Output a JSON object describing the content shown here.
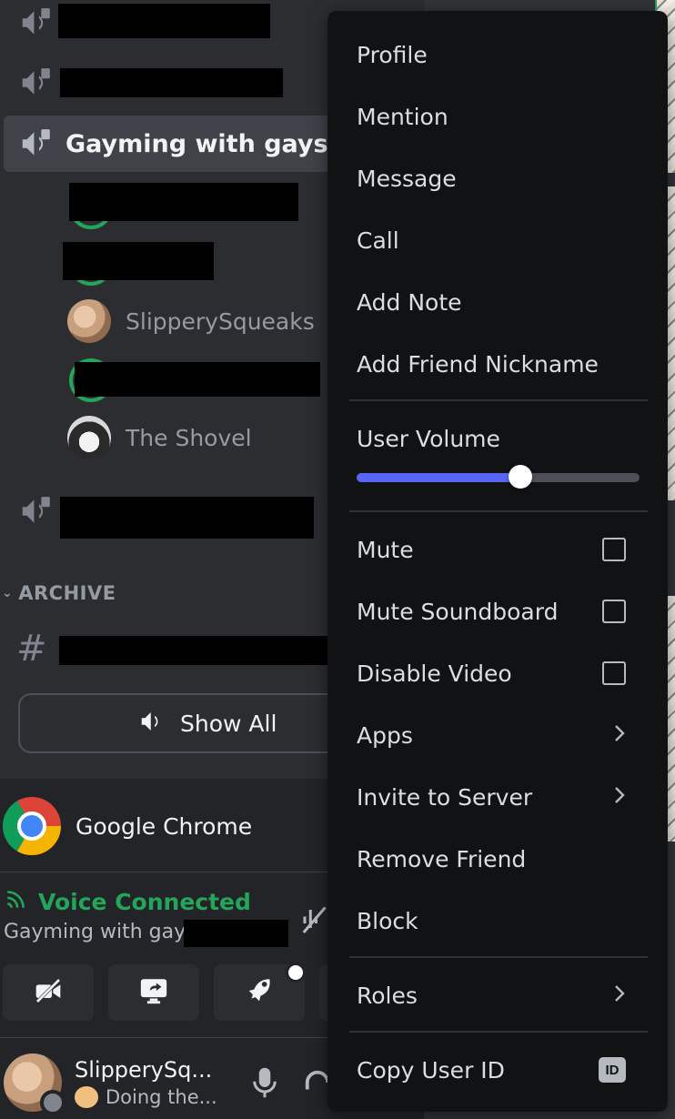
{
  "sidebar": {
    "active_channel": "Gayming with gays?",
    "members": [
      {
        "name": "SlipperySqueaks"
      },
      {
        "name": "The Shovel"
      }
    ],
    "category": "ARCHIVE",
    "text_channel_icon": "#",
    "show_all_label": "Show All"
  },
  "activity": {
    "app_name": "Google Chrome"
  },
  "voice": {
    "status": "Voice Connected",
    "channel": "Gayming with gays?"
  },
  "user": {
    "name": "SlipperySq...",
    "activity": "Doing the..."
  },
  "context_menu": {
    "items": {
      "profile": "Profile",
      "mention": "Mention",
      "message": "Message",
      "call": "Call",
      "add_note": "Add Note",
      "add_friend_nickname": "Add Friend Nickname",
      "user_volume": "User Volume",
      "mute": "Mute",
      "mute_soundboard": "Mute Soundboard",
      "disable_video": "Disable Video",
      "apps": "Apps",
      "invite_to_server": "Invite to Server",
      "remove_friend": "Remove Friend",
      "block": "Block",
      "roles": "Roles",
      "copy_user_id": "Copy User ID"
    },
    "user_volume_level": 0.58,
    "id_badge": "ID"
  },
  "colors": {
    "accent": "#5865f2",
    "voice_green": "#23a55a",
    "menu_bg": "#111214",
    "sidebar_bg": "#2b2d31"
  }
}
